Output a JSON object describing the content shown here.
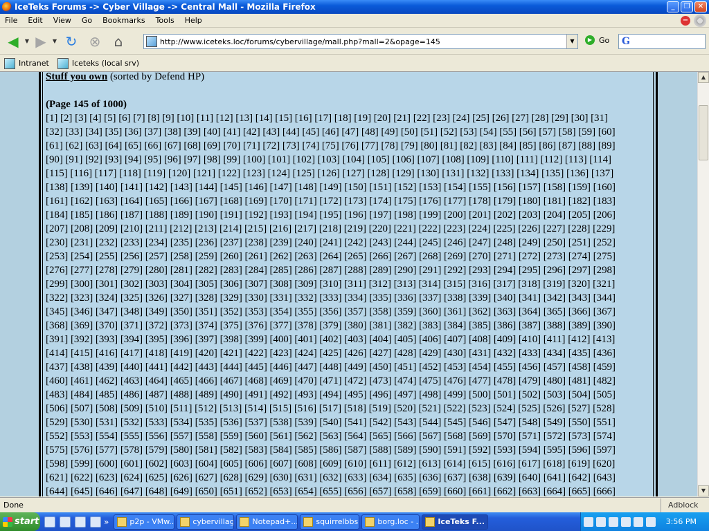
{
  "window": {
    "title": "IceTeks Forums -> Cyber Village -> Central Mall - Mozilla Firefox",
    "minimize": "_",
    "restore": "❐",
    "close": "✕"
  },
  "menu": [
    "File",
    "Edit",
    "View",
    "Go",
    "Bookmarks",
    "Tools",
    "Help"
  ],
  "nav": {
    "url": "http://www.iceteks.loc/forums/cybervillage/mall.php?mall=2&opage=145",
    "go_label": "Go",
    "search_placeholder": ""
  },
  "bookmarks": [
    "Intranet",
    "Iceteks (local srv)"
  ],
  "content": {
    "stuff_link": "Stuff you own",
    "stuff_suffix": " (sorted by Defend HP)",
    "page_label": "(Page 145 of 1000)",
    "page_rows": [
      "[1] [2] [3] [4] [5] [6] [7] [8] [9] [10] [11] [12] [13] [14] [15] [16] [17] [18] [19] [20] [21] [22] [23] [24] [25] [26] [27] [28] [29] [30] [31]",
      "[32] [33] [34] [35] [36] [37] [38] [39] [40] [41] [42] [43] [44] [45] [46] [47] [48] [49] [50] [51] [52] [53] [54] [55] [56] [57] [58] [59] [60]",
      "[61] [62] [63] [64] [65] [66] [67] [68] [69] [70] [71] [72] [73] [74] [75] [76] [77] [78] [79] [80] [81] [82] [83] [84] [85] [86] [87] [88] [89]",
      "[90] [91] [92] [93] [94] [95] [96] [97] [98] [99] [100] [101] [102] [103] [104] [105] [106] [107] [108] [109] [110] [111] [112] [113] [114]",
      "[115] [116] [117] [118] [119] [120] [121] [122] [123] [124] [125] [126] [127] [128] [129] [130] [131] [132] [133] [134] [135] [136] [137]",
      "[138] [139] [140] [141] [142] [143] [144] [145] [146] [147] [148] [149] [150] [151] [152] [153] [154] [155] [156] [157] [158] [159] [160]",
      "[161] [162] [163] [164] [165] [166] [167] [168] [169] [170] [171] [172] [173] [174] [175] [176] [177] [178] [179] [180] [181] [182] [183]",
      "[184] [185] [186] [187] [188] [189] [190] [191] [192] [193] [194] [195] [196] [197] [198] [199] [200] [201] [202] [203] [204] [205] [206]",
      "[207] [208] [209] [210] [211] [212] [213] [214] [215] [216] [217] [218] [219] [220] [221] [222] [223] [224] [225] [226] [227] [228] [229]",
      "[230] [231] [232] [233] [234] [235] [236] [237] [238] [239] [240] [241] [242] [243] [244] [245] [246] [247] [248] [249] [250] [251] [252]",
      "[253] [254] [255] [256] [257] [258] [259] [260] [261] [262] [263] [264] [265] [266] [267] [268] [269] [270] [271] [272] [273] [274] [275]",
      "[276] [277] [278] [279] [280] [281] [282] [283] [284] [285] [286] [287] [288] [289] [290] [291] [292] [293] [294] [295] [296] [297] [298]",
      "[299] [300] [301] [302] [303] [304] [305] [306] [307] [308] [309] [310] [311] [312] [313] [314] [315] [316] [317] [318] [319] [320] [321]",
      "[322] [323] [324] [325] [326] [327] [328] [329] [330] [331] [332] [333] [334] [335] [336] [337] [338] [339] [340] [341] [342] [343] [344]",
      "[345] [346] [347] [348] [349] [350] [351] [352] [353] [354] [355] [356] [357] [358] [359] [360] [361] [362] [363] [364] [365] [366] [367]",
      "[368] [369] [370] [371] [372] [373] [374] [375] [376] [377] [378] [379] [380] [381] [382] [383] [384] [385] [386] [387] [388] [389] [390]",
      "[391] [392] [393] [394] [395] [396] [397] [398] [399] [400] [401] [402] [403] [404] [405] [406] [407] [408] [409] [410] [411] [412] [413]",
      "[414] [415] [416] [417] [418] [419] [420] [421] [422] [423] [424] [425] [426] [427] [428] [429] [430] [431] [432] [433] [434] [435] [436]",
      "[437] [438] [439] [440] [441] [442] [443] [444] [445] [446] [447] [448] [449] [450] [451] [452] [453] [454] [455] [456] [457] [458] [459]",
      "[460] [461] [462] [463] [464] [465] [466] [467] [468] [469] [470] [471] [472] [473] [474] [475] [476] [477] [478] [479] [480] [481] [482]",
      "[483] [484] [485] [486] [487] [488] [489] [490] [491] [492] [493] [494] [495] [496] [497] [498] [499] [500] [501] [502] [503] [504] [505]",
      "[506] [507] [508] [509] [510] [511] [512] [513] [514] [515] [516] [517] [518] [519] [520] [521] [522] [523] [524] [525] [526] [527] [528]",
      "[529] [530] [531] [532] [533] [534] [535] [536] [537] [538] [539] [540] [541] [542] [543] [544] [545] [546] [547] [548] [549] [550] [551]",
      "[552] [553] [554] [555] [556] [557] [558] [559] [560] [561] [562] [563] [564] [565] [566] [567] [568] [569] [570] [571] [572] [573] [574]",
      "[575] [576] [577] [578] [579] [580] [581] [582] [583] [584] [585] [586] [587] [588] [589] [590] [591] [592] [593] [594] [595] [596] [597]",
      "[598] [599] [600] [601] [602] [603] [604] [605] [606] [607] [608] [609] [610] [611] [612] [613] [614] [615] [616] [617] [618] [619] [620]",
      "[621] [622] [623] [624] [625] [626] [627] [628] [629] [630] [631] [632] [633] [634] [635] [636] [637] [638] [639] [640] [641] [642] [643]",
      "[644] [645] [646] [647] [648] [649] [650] [651] [652] [653] [654] [655] [656] [657] [658] [659] [660] [661] [662] [663] [664] [665] [666]"
    ]
  },
  "status": {
    "text": "Done",
    "adblock": "Adblock"
  },
  "taskbar": {
    "start": "start",
    "more": "»",
    "tasks": [
      {
        "label": "p2p - VMw...",
        "active": false
      },
      {
        "label": "cybervillage",
        "active": false
      },
      {
        "label": "Notepad+...",
        "active": false
      },
      {
        "label": "squirrelbbs",
        "active": false
      },
      {
        "label": "borg.loc - ...",
        "active": false
      },
      {
        "label": "IceTeks F...",
        "active": true
      }
    ],
    "clock": "3:56 PM"
  }
}
